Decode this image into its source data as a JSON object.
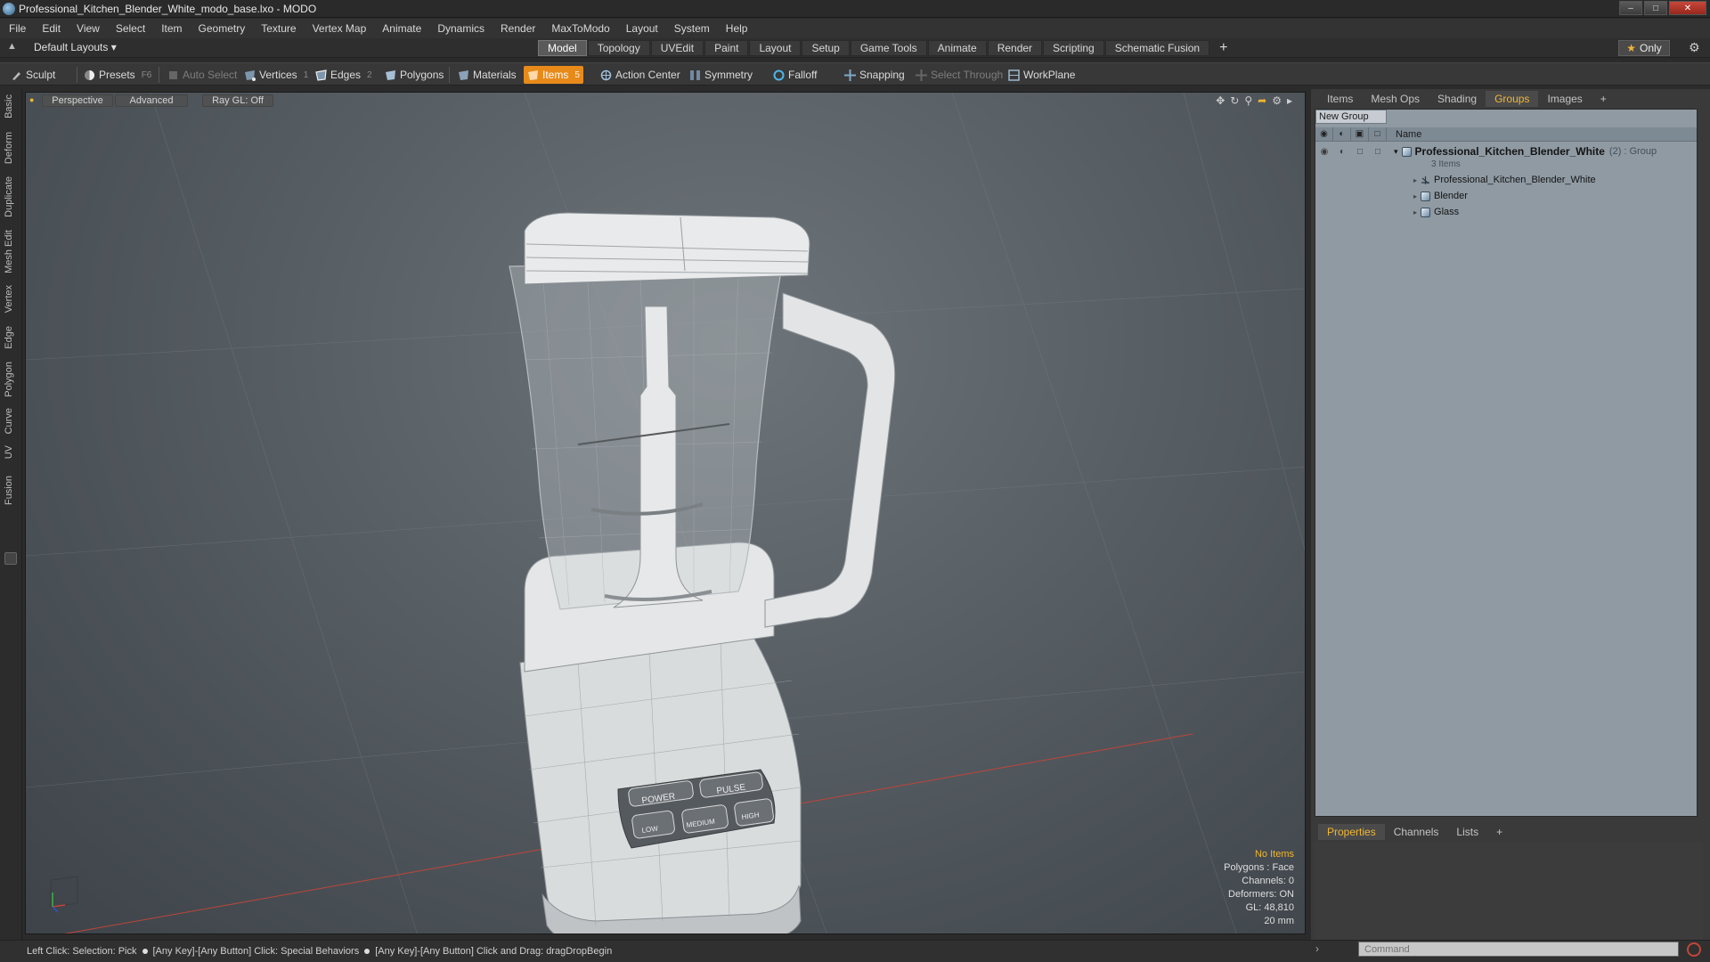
{
  "window": {
    "title": "Professional_Kitchen_Blender_White_modo_base.lxo - MODO"
  },
  "menu": [
    "File",
    "Edit",
    "View",
    "Select",
    "Item",
    "Geometry",
    "Texture",
    "Vertex Map",
    "Animate",
    "Dynamics",
    "Render",
    "MaxToModo",
    "Layout",
    "System",
    "Help"
  ],
  "layout": {
    "selector": "Default Layouts",
    "tabs": [
      "Model",
      "Topology",
      "UVEdit",
      "Paint",
      "Layout",
      "Setup",
      "Game Tools",
      "Animate",
      "Render",
      "Scripting",
      "Schematic Fusion"
    ],
    "active_tab": "Model",
    "only_label": "Only"
  },
  "toolbar": {
    "sculpt": "Sculpt",
    "presets": "Presets",
    "presets_key": "F6",
    "auto_select": "Auto Select",
    "vertices": "Vertices",
    "vertices_count": "1",
    "edges": "Edges",
    "edges_count": "2",
    "polygons": "Polygons",
    "materials": "Materials",
    "items": "Items",
    "items_count": "5",
    "action_center": "Action Center",
    "symmetry": "Symmetry",
    "falloff": "Falloff",
    "snapping": "Snapping",
    "select_through": "Select Through",
    "workplane": "WorkPlane"
  },
  "left_tabs": [
    "Basic",
    "Deform",
    "Duplicate",
    "Mesh Edit",
    "Vertex",
    "Edge",
    "Polygon",
    "Curve",
    "UV",
    "Fusion"
  ],
  "viewport": {
    "view": "Perspective",
    "mode": "Advanced",
    "raygl": "Ray GL: Off",
    "buttons": [
      "POWER",
      "PULSE",
      "LOW",
      "MEDIUM",
      "HIGH"
    ],
    "info": {
      "items": "No Items",
      "polygons": "Polygons : Face",
      "channels": "Channels: 0",
      "deformers": "Deformers: ON",
      "gl": "GL: 48,810",
      "scale": "20 mm"
    }
  },
  "right_panel": {
    "tabs": [
      "Items",
      "Mesh Ops",
      "Shading",
      "Groups",
      "Images"
    ],
    "active_tab": "Groups",
    "new_group": "New Group",
    "column_name": "Name",
    "group": {
      "name": "Professional_Kitchen_Blender_White",
      "count": "(2)",
      "type": ": Group",
      "items_label": "3 Items"
    },
    "children": [
      "Professional_Kitchen_Blender_White",
      "Blender",
      "Glass"
    ],
    "bottom_tabs": [
      "Properties",
      "Channels",
      "Lists"
    ],
    "bottom_active": "Properties"
  },
  "status": {
    "hint1": "Left Click: Selection: Pick",
    "hint2": "[Any Key]-[Any Button] Click: Special Behaviors",
    "hint3": "[Any Key]-[Any Button] Click and Drag: dragDropBegin",
    "command_placeholder": "Command"
  },
  "colors": {
    "accent": "#e88a1a",
    "info_highlight": "#f2b632",
    "group_panel": "#8f9aa3"
  }
}
